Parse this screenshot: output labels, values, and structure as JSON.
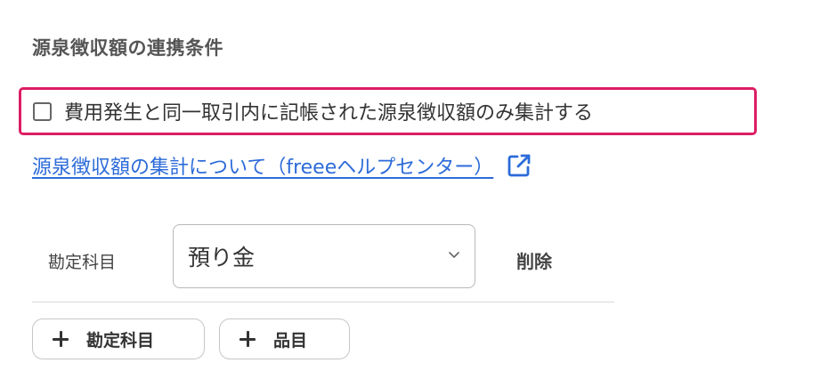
{
  "section": {
    "title": "源泉徴収額の連携条件"
  },
  "option": {
    "checked": false,
    "label": "費用発生と同一取引内に記帳された源泉徴収額のみ集計する"
  },
  "help": {
    "link_text": "源泉徴収額の集計について（freeeヘルプセンター）",
    "icon": "external-link-icon",
    "color": "#2c6bd9"
  },
  "account_row": {
    "label": "勘定科目",
    "selected_value": "預り金",
    "delete_label": "削除"
  },
  "add_buttons": {
    "account_label": "勘定科目",
    "item_label": "品目"
  },
  "colors": {
    "highlight": "#dc1e64",
    "link": "#2c6bd9"
  }
}
